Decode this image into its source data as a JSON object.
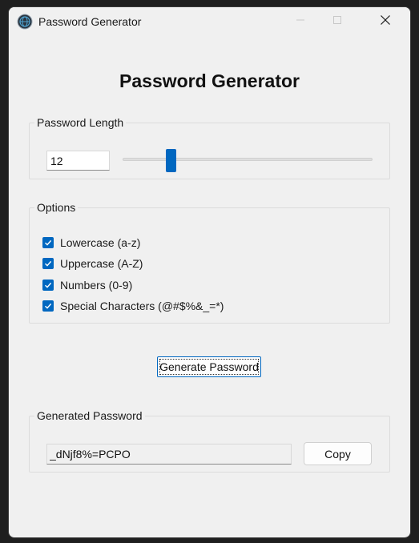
{
  "window": {
    "title": "Password Generator",
    "icon": "globe-app-icon"
  },
  "header": {
    "title": "Password Generator"
  },
  "length_group": {
    "legend": "Password Length",
    "value": "12",
    "slider_level": 0.18
  },
  "options_group": {
    "legend": "Options",
    "items": [
      {
        "label": "Lowercase (a-z)",
        "checked": true
      },
      {
        "label": "Uppercase (A-Z)",
        "checked": true
      },
      {
        "label": "Numbers (0-9)",
        "checked": true
      },
      {
        "label": "Special Characters (@#$%&_=*)",
        "checked": true
      }
    ]
  },
  "actions": {
    "generate_label": "Generate Password"
  },
  "output_group": {
    "legend": "Generated Password",
    "password": "_dNjf8%=PCPO",
    "copy_label": "Copy"
  },
  "colors": {
    "accent": "#0067c0",
    "window_bg": "#f0f0f0",
    "desktop_bg": "#1f1f1f"
  }
}
